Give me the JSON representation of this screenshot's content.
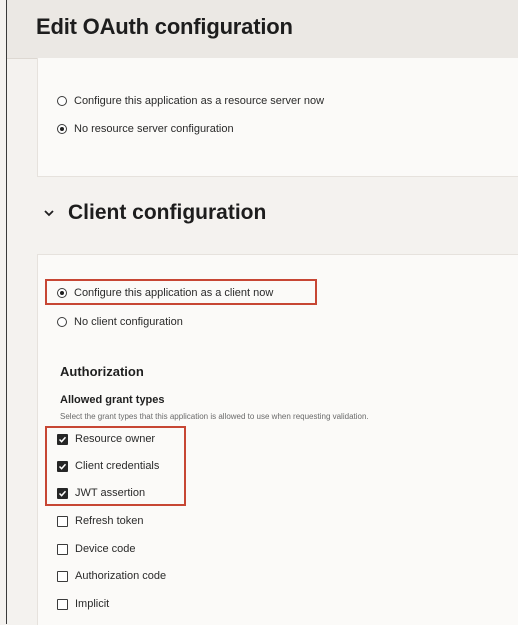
{
  "page": {
    "title": "Edit OAuth configuration"
  },
  "resource_server": {
    "options": [
      {
        "label": "Configure this application as a resource server now",
        "selected": false
      },
      {
        "label": "No resource server configuration",
        "selected": true
      }
    ]
  },
  "client_section": {
    "title": "Client configuration",
    "options": [
      {
        "label": "Configure this application as a client now",
        "selected": true
      },
      {
        "label": "No client configuration",
        "selected": false
      }
    ],
    "authorization_heading": "Authorization",
    "grant_types_heading": "Allowed grant types",
    "grant_types_help": "Select the grant types that this application is allowed to use when requesting validation.",
    "grant_types": [
      {
        "label": "Resource owner",
        "checked": true
      },
      {
        "label": "Client credentials",
        "checked": true
      },
      {
        "label": "JWT assertion",
        "checked": true
      },
      {
        "label": "Refresh token",
        "checked": false
      },
      {
        "label": "Device code",
        "checked": false
      },
      {
        "label": "Authorization code",
        "checked": false
      },
      {
        "label": "Implicit",
        "checked": false
      }
    ]
  },
  "colors": {
    "highlight": "#c74634",
    "page_bg": "#f4f2ef",
    "card_bg": "#fbfaf8"
  }
}
